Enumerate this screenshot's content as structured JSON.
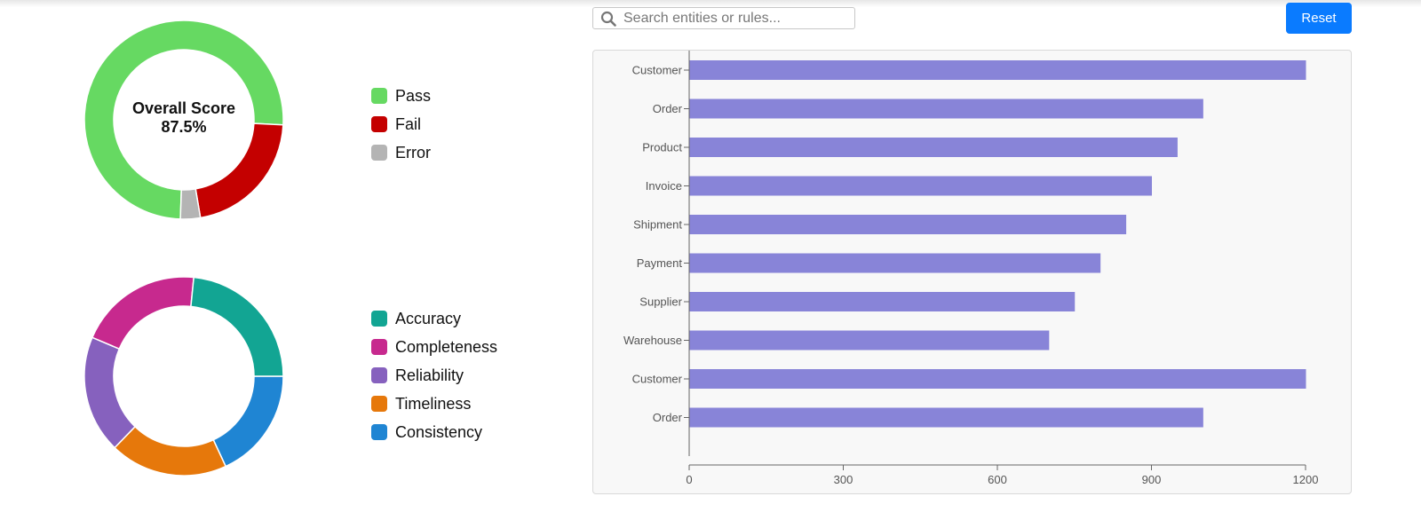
{
  "score": {
    "title": "Overall Score",
    "value": "87.5%",
    "segments": [
      {
        "name": "Pass",
        "value": 70.0,
        "color": "#66d962"
      },
      {
        "name": "Fail",
        "value": 20.0,
        "color": "#c40000"
      },
      {
        "name": "Error",
        "value": 3.0,
        "color": "#b4b4b4"
      }
    ]
  },
  "dimensions": {
    "segments": [
      {
        "name": "Accuracy",
        "value": 22,
        "color": "#12a593"
      },
      {
        "name": "Completeness",
        "value": 19,
        "color": "#c7298e"
      },
      {
        "name": "Reliability",
        "value": 18,
        "color": "#8661be"
      },
      {
        "name": "Timeliness",
        "value": 18,
        "color": "#e6780b"
      },
      {
        "name": "Consistency",
        "value": 17,
        "color": "#1f85d3"
      }
    ]
  },
  "search": {
    "placeholder": "Search entities or rules..."
  },
  "toolbar": {
    "reset_label": "Reset",
    "reset_color": "#0a7bff"
  },
  "chart_data": {
    "type": "bar",
    "orientation": "horizontal",
    "categories": [
      "Customer",
      "Order",
      "Product",
      "Invoice",
      "Shipment",
      "Payment",
      "Supplier",
      "Warehouse",
      "Customer",
      "Order"
    ],
    "values": [
      1200,
      1000,
      950,
      900,
      850,
      800,
      750,
      700,
      1200,
      1000
    ],
    "xlim": [
      0,
      1200
    ],
    "xticks": [
      0,
      300,
      600,
      900,
      1200
    ],
    "bar_color": "#8884d8",
    "grid": false
  }
}
